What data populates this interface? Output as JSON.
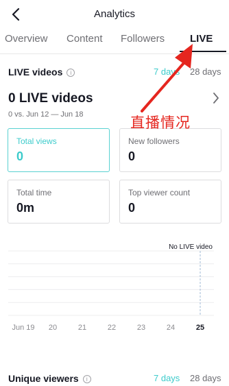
{
  "header": {
    "title": "Analytics",
    "back_icon": "chevron-left-icon"
  },
  "tabs": [
    {
      "label": "Overview",
      "active": false
    },
    {
      "label": "Content",
      "active": false
    },
    {
      "label": "Followers",
      "active": false
    },
    {
      "label": "LIVE",
      "active": true
    }
  ],
  "live_section": {
    "title": "LIVE videos",
    "info_icon": "info-icon",
    "ranges": [
      "7 days",
      "28 days"
    ],
    "selected_range": "7 days",
    "count_label": "0 LIVE videos",
    "compare_label": "0 vs. Jun 12 — Jun 18"
  },
  "metrics": [
    {
      "label": "Total views",
      "value": "0",
      "active": true
    },
    {
      "label": "New followers",
      "value": "0",
      "active": false
    },
    {
      "label": "Total time",
      "value": "0m",
      "active": false
    },
    {
      "label": "Top viewer count",
      "value": "0",
      "active": false
    }
  ],
  "chart_data": {
    "type": "line",
    "x": [
      "Jun 19",
      "20",
      "21",
      "22",
      "23",
      "24",
      "25"
    ],
    "series": [],
    "annotation": "No LIVE video",
    "highlight_x": "25",
    "grid": true,
    "ylabel": "",
    "xlabel": ""
  },
  "unique_viewers": {
    "title": "Unique viewers",
    "ranges": [
      "7 days",
      "28 days"
    ],
    "selected_range": "7 days"
  },
  "annotation": {
    "text": "直播情况",
    "color": "#e5261f"
  },
  "colors": {
    "accent": "#3ccbcb",
    "text": "#161823",
    "muted": "#6e6e73",
    "annotation": "#e5261f"
  }
}
